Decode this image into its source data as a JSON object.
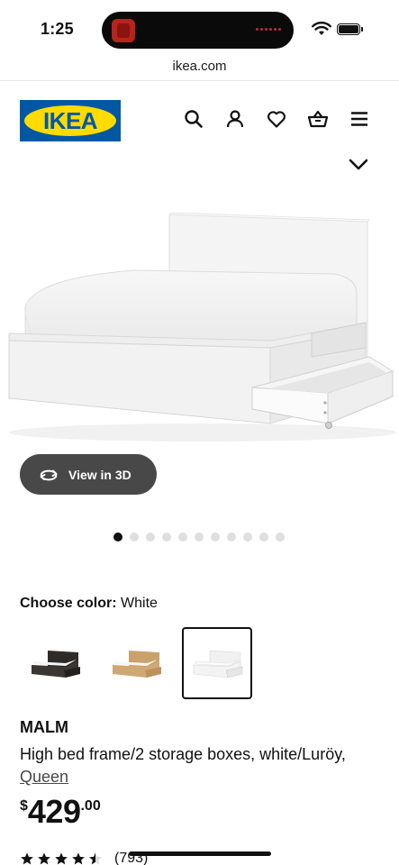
{
  "status_bar": {
    "time": "1:25"
  },
  "browser": {
    "url": "ikea.com"
  },
  "header": {
    "logo_text": "IKEA",
    "icons": [
      "search-icon",
      "account-icon",
      "heart-icon",
      "cart-icon",
      "menu-icon"
    ]
  },
  "product": {
    "view_3d_label": "View in 3D",
    "image_count": 11,
    "active_image_index": 0,
    "color_label": "Choose color:",
    "color_value": "White",
    "swatches": [
      "black-brown",
      "oak veneer",
      "white"
    ],
    "selected_swatch": "white",
    "name": "MALM",
    "description": "High bed frame/2 storage boxes, white/Luröy,",
    "size": "Queen",
    "price": {
      "currency": "$",
      "integer": "429",
      "decimal": ".00"
    },
    "rating": {
      "stars": 4.5,
      "count": "(793)"
    }
  },
  "colors": {
    "ikea_blue": "#0058a3",
    "ikea_yellow": "#ffdb00",
    "button_dark": "#484848"
  }
}
